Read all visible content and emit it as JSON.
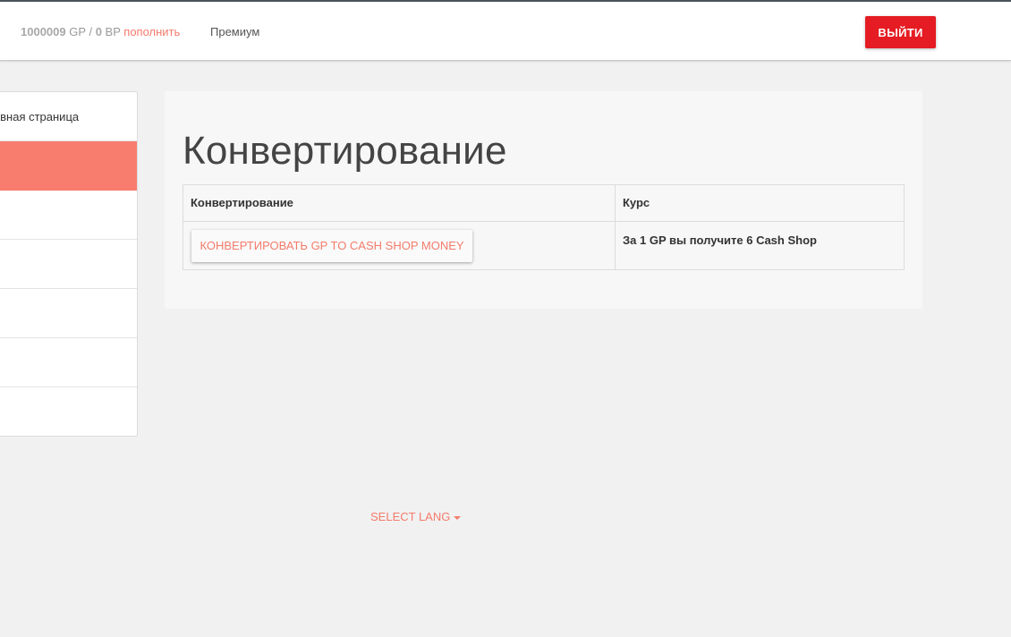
{
  "header": {
    "gp_amount": "1000009",
    "gp_unit": "GP",
    "separator": "/",
    "bp_amount": "0",
    "bp_unit": "BP",
    "topup_label": "пополнить",
    "premium_label": "Премиум",
    "logout_label": "ВЫЙТИ"
  },
  "sidebar": {
    "items": [
      {
        "label": "Главная страница"
      },
      {
        "label": ""
      },
      {
        "label": ""
      },
      {
        "label": ""
      },
      {
        "label": ""
      },
      {
        "label": ""
      },
      {
        "label": ""
      }
    ],
    "active_index": 1
  },
  "main": {
    "title": "Конвертирование",
    "table": {
      "headers": [
        "Конвертирование",
        "Курс"
      ],
      "rows": [
        {
          "button_label": "КОНВЕРТИРОВАТЬ GP TO CASH SHOP MONEY",
          "rate": "За 1 GP вы получите 6 Cash Shop"
        }
      ]
    }
  },
  "footer": {
    "lang_label": "SELECT LANG",
    "lang_icon": "caret-down-icon"
  },
  "colors": {
    "accent": "#f47b6b",
    "active_item": "#f87d6f",
    "logout": "#e51c23"
  }
}
